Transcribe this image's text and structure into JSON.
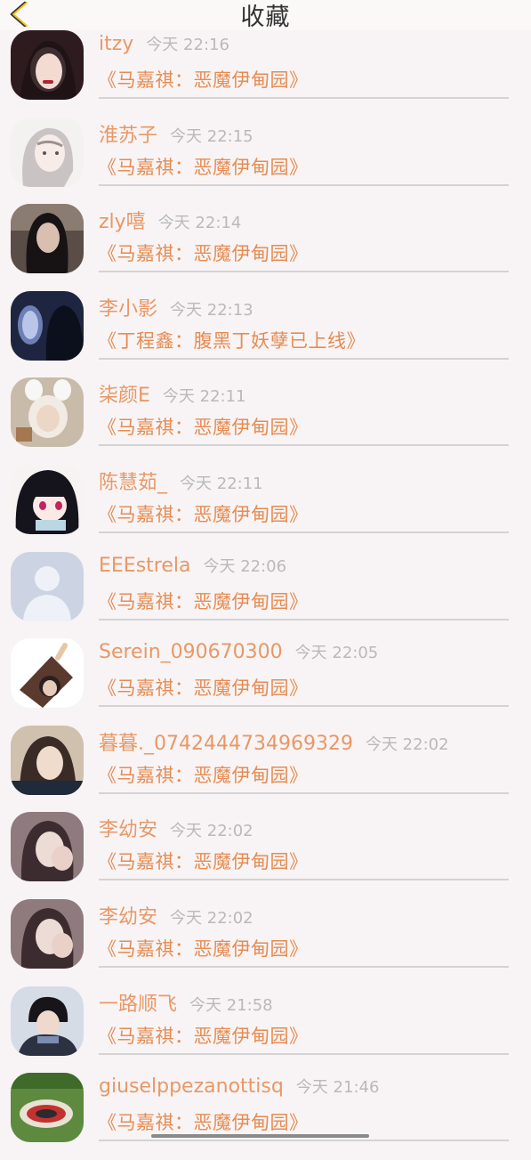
{
  "header": {
    "title": "收藏",
    "back_icon": "chevron-left-icon"
  },
  "colors": {
    "accent": "#e89866",
    "time": "#b9b9b9",
    "divider": "#d3d3d3",
    "background": "#f8f4f5"
  },
  "favorites": [
    {
      "user": "itzy",
      "time": "今天 22:16",
      "story": "《马嘉祺：恶魔伊甸园》",
      "avatar": "avatar-photo-dark-hair"
    },
    {
      "user": "淮苏子",
      "time": "今天 22:15",
      "story": "《马嘉祺：恶魔伊甸园》",
      "avatar": "avatar-illustration-girl"
    },
    {
      "user": "zly嘻",
      "time": "今天 22:14",
      "story": "《马嘉祺：恶魔伊甸园》",
      "avatar": "avatar-photo-dark"
    },
    {
      "user": "李小影",
      "time": "今天 22:13",
      "story": "《丁程鑫：腹黑丁妖孽已上线》",
      "avatar": "avatar-photo-window"
    },
    {
      "user": "柒颜E",
      "time": "今天 22:11",
      "story": "《马嘉祺：恶魔伊甸园》",
      "avatar": "avatar-photo-bunny"
    },
    {
      "user": "陈慧茹_",
      "time": "今天 22:11",
      "story": "《马嘉祺：恶魔伊甸园》",
      "avatar": "avatar-anime-girl"
    },
    {
      "user": "EEEstrela",
      "time": "今天 22:06",
      "story": "《马嘉祺：恶魔伊甸园》",
      "avatar": "avatar-default-placeholder"
    },
    {
      "user": "Serein_090670300",
      "time": "今天 22:05",
      "story": "《马嘉祺：恶魔伊甸园》",
      "avatar": "avatar-ice-cream"
    },
    {
      "user": "暮暮._0742444734969329",
      "time": "今天 22:02",
      "story": "《马嘉祺：恶魔伊甸园》",
      "avatar": "avatar-photo-girl"
    },
    {
      "user": "李幼安",
      "time": "今天 22:02",
      "story": "《马嘉祺：恶魔伊甸园》",
      "avatar": "avatar-photo-hand"
    },
    {
      "user": "李幼安",
      "time": "今天 22:02",
      "story": "《马嘉祺：恶魔伊甸园》",
      "avatar": "avatar-photo-hand"
    },
    {
      "user": "一路顺飞",
      "time": "今天 21:58",
      "story": "《马嘉祺：恶魔伊甸园》",
      "avatar": "avatar-photo-boy"
    },
    {
      "user": "giuselppezanottisq",
      "time": "今天 21:46",
      "story": "《马嘉祺：恶魔伊甸园》",
      "avatar": "avatar-photo-colorful"
    }
  ]
}
